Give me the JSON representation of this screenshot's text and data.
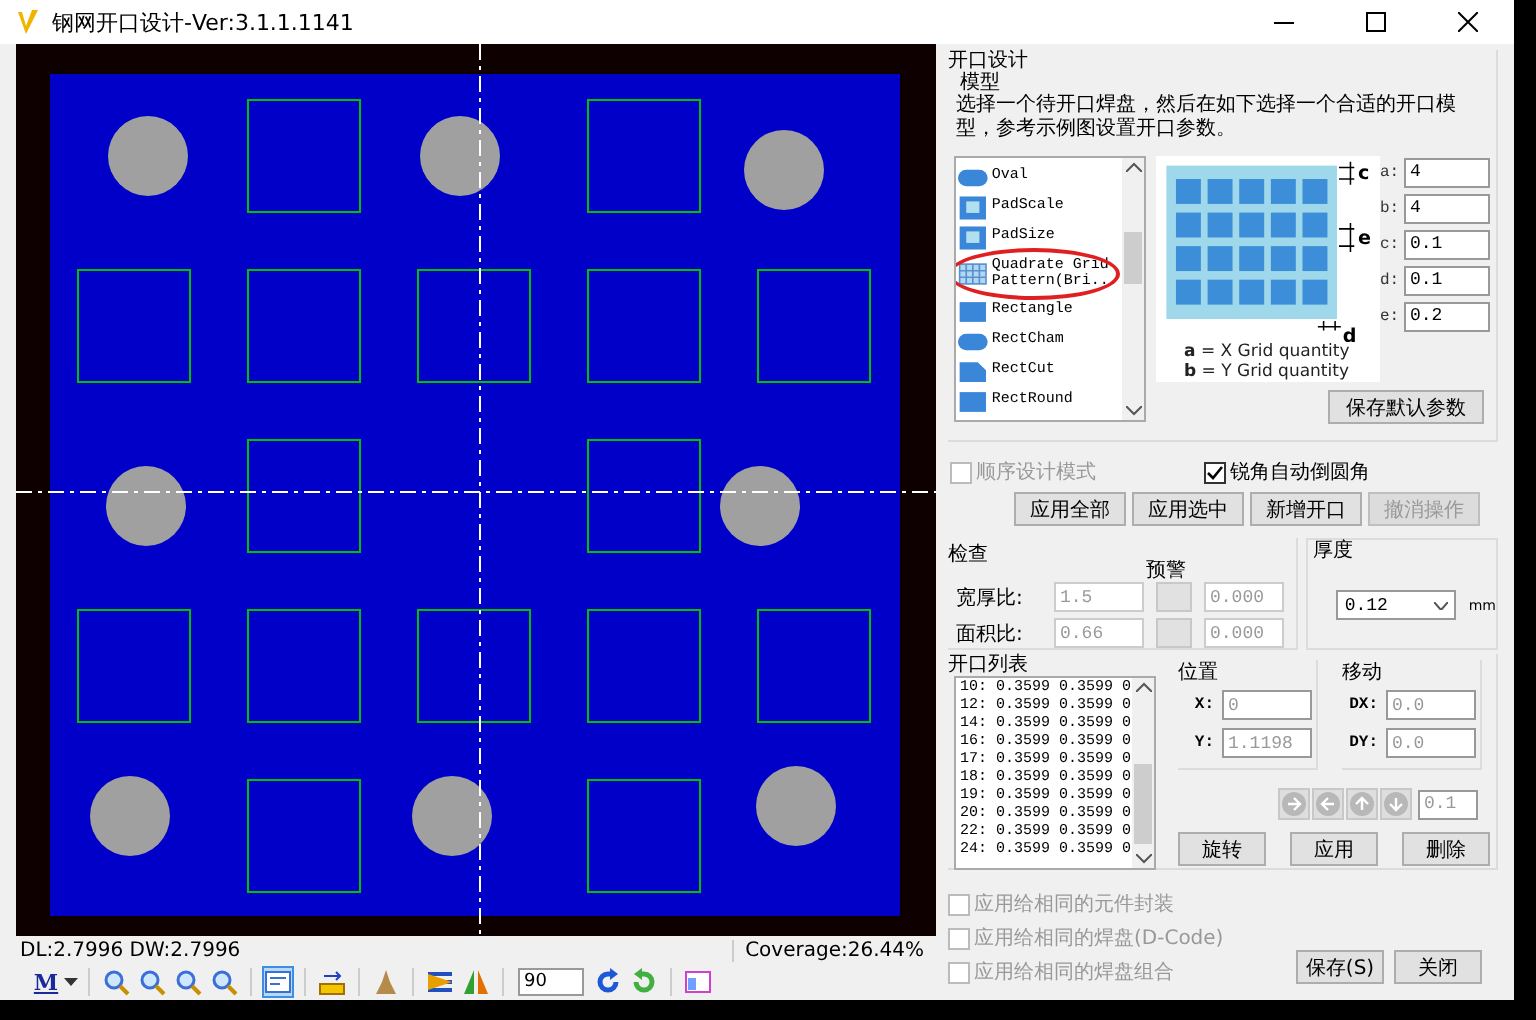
{
  "window": {
    "title": "钢网开口设计-Ver:3.1.1.1141"
  },
  "design": {
    "title": "开口设计",
    "model_label": "模型",
    "description": "选择一个待开口焊盘，然后在如下选择一个合适的开口模型，参考示例图设置开口参数。",
    "models": [
      {
        "label": "Oval",
        "kind": "oval",
        "highlighted": false
      },
      {
        "label": "PadScale",
        "kind": "pad",
        "highlighted": false
      },
      {
        "label": "PadSize",
        "kind": "pad",
        "highlighted": false
      },
      {
        "label": "Quadrate Grid Pattern(Bri...",
        "kind": "grid",
        "highlighted": true
      },
      {
        "label": "Rectangle",
        "kind": "rect",
        "highlighted": false
      },
      {
        "label": "RectCham",
        "kind": "oval",
        "highlighted": false
      },
      {
        "label": "RectCut",
        "kind": "cut",
        "highlighted": false
      },
      {
        "label": "RectRound",
        "kind": "rect",
        "highlighted": false
      }
    ],
    "diagram": {
      "marks": [
        "c",
        "e",
        "d"
      ],
      "legend": [
        "**a** = X  Grid quantity",
        "**b** = Y  Grid quantity"
      ]
    },
    "params": [
      {
        "label": "a:",
        "value": "4"
      },
      {
        "label": "b:",
        "value": "4"
      },
      {
        "label": "c:",
        "value": "0.1"
      },
      {
        "label": "d:",
        "value": "0.1"
      },
      {
        "label": "e:",
        "value": "0.2"
      }
    ],
    "save_defaults": "保存默认参数"
  },
  "options": [
    {
      "label": "顺序设计模式",
      "checked": false,
      "disabled": true
    },
    {
      "label": "锐角自动倒圆角",
      "checked": true,
      "disabled": false
    }
  ],
  "actions": [
    {
      "label": "应用全部",
      "disabled": false
    },
    {
      "label": "应用选中",
      "disabled": false
    },
    {
      "label": "新增开口",
      "disabled": false
    },
    {
      "label": "撤消操作",
      "disabled": true
    }
  ],
  "check": {
    "title": "检查",
    "warning_label": "预警",
    "rows": [
      {
        "label": "宽厚比:",
        "value": "1.5",
        "warning": "0.000"
      },
      {
        "label": "面积比:",
        "value": "0.66",
        "warning": "0.000"
      }
    ]
  },
  "thickness": {
    "title": "厚度",
    "value": "0.12",
    "unit": "mm"
  },
  "aperture_list": {
    "title": "开口列表",
    "rows": [
      "10: 0.3599 0.3599 0",
      "12: 0.3599 0.3599 0",
      "14: 0.3599 0.3599 0",
      "16: 0.3599 0.3599 0",
      "17: 0.3599 0.3599 0",
      "18: 0.3599 0.3599 0",
      "19: 0.3599 0.3599 0",
      "20: 0.3599 0.3599 0",
      "22: 0.3599 0.3599 0",
      "24: 0.3599 0.3599 0"
    ],
    "position": {
      "title": "位置",
      "fields": [
        {
          "label": "X:",
          "value": "0"
        },
        {
          "label": "Y:",
          "value": "1.1198"
        }
      ]
    },
    "move": {
      "title": "移动",
      "fields": [
        {
          "label": "DX:",
          "value": "0.0"
        },
        {
          "label": "DY:",
          "value": "0.0"
        }
      ]
    },
    "nudge_buttons": [
      {
        "kind": "right",
        "disabled": true
      },
      {
        "kind": "left",
        "disabled": true
      },
      {
        "kind": "up",
        "disabled": true
      },
      {
        "kind": "down",
        "disabled": true
      }
    ],
    "step": "0.1",
    "buttons": [
      "旋转",
      "应用",
      "删除"
    ]
  },
  "apply_to": [
    {
      "label": "应用给相同的元件封装",
      "checked": false,
      "disabled": true
    },
    {
      "label": "应用给相同的焊盘(D-Code)",
      "checked": false,
      "disabled": true
    },
    {
      "label": "应用给相同的焊盘组合",
      "checked": false,
      "disabled": true
    }
  ],
  "footer_buttons": [
    "保存(S)",
    "关闭"
  ],
  "status": {
    "dimensions": "DL:2.7996 DW:2.7996",
    "coverage": "Coverage:26.44%"
  },
  "toolbar": {
    "mode_label": "M",
    "angle": "90",
    "tools": [
      {
        "kind": "zoom",
        "selected": false,
        "divider_before": true
      },
      {
        "kind": "zoom",
        "selected": false,
        "divider_before": false
      },
      {
        "kind": "zoom",
        "selected": false,
        "divider_before": false
      },
      {
        "kind": "zoom",
        "selected": false,
        "divider_before": false
      },
      {
        "kind": "view",
        "selected": true,
        "divider_before": true
      },
      {
        "kind": "ruler",
        "selected": false,
        "divider_before": true
      },
      {
        "kind": "brush",
        "selected": false,
        "divider_before": true
      },
      {
        "kind": "mirror-h",
        "selected": false,
        "divider_before": true
      },
      {
        "kind": "mirror-v",
        "selected": false,
        "divider_before": false
      },
      {
        "kind": "angle",
        "divider_before": true
      },
      {
        "kind": "rotate-cw",
        "selected": false,
        "divider_before": false
      },
      {
        "kind": "rotate-ccw",
        "selected": false,
        "divider_before": false
      },
      {
        "kind": "panel",
        "selected": false,
        "divider_before": true
      }
    ]
  }
}
